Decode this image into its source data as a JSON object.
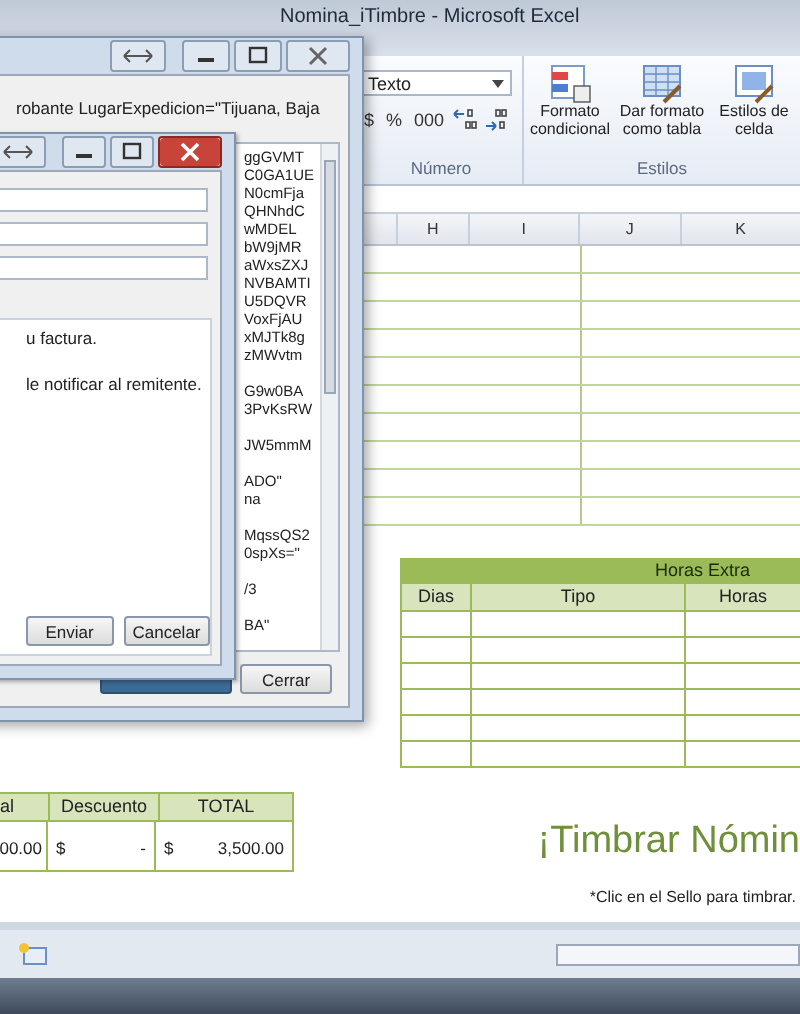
{
  "window": {
    "title": "Nomina_iTimbre - Microsoft Excel"
  },
  "ribbon": {
    "number_format": "Texto",
    "number_buttons": [
      "$",
      "%",
      "000"
    ],
    "number_group": "Número",
    "styles": [
      {
        "label": "Formato condicional",
        "kind": "conditional"
      },
      {
        "label": "Dar formato como tabla",
        "kind": "table"
      },
      {
        "label": "Estilos de celda",
        "kind": "cell"
      }
    ],
    "styles_group": "Estilos"
  },
  "columns": [
    "H",
    "I",
    "J",
    "K"
  ],
  "overtime": {
    "title": "Horas Extra",
    "columns": [
      "Dias",
      "Tipo",
      "Horas"
    ]
  },
  "totals": {
    "columns": [
      "al",
      "Descuento",
      "TOTAL"
    ],
    "cells": [
      {
        "amount": "00.00"
      },
      {
        "currency": "$",
        "amount": "-"
      },
      {
        "currency": "$",
        "amount": "3,500.00"
      }
    ]
  },
  "stamp": {
    "heading": "¡Timbrar Nómin",
    "note": "*Clic en el Sello para timbrar."
  },
  "xml_window": {
    "header_text": "robante LugarExpedicion=\"Tijuana, Baja",
    "line_groups": [
      [
        "ggGVMT",
        "C0GA1UE",
        "N0cmFja",
        "QHNhdC",
        "wMDEL",
        "bW9jMR",
        "aWxsZXJ",
        "NVBAMTI",
        "U5DQVR",
        "VoxFjAU",
        "xMJTk8g",
        "zMWvtm"
      ],
      [
        "G9w0BA",
        "3PvKsRW"
      ],
      [
        "JW5mmM"
      ],
      [
        "ADO\"",
        "na"
      ],
      [
        "MqssQS2",
        "0spXs=\""
      ],
      [
        "/3"
      ],
      [
        "BA\""
      ]
    ],
    "button": "Cerrar"
  },
  "mail_dialog": {
    "messages": [
      "u factura.",
      "le notificar al remitente."
    ],
    "buttons": [
      "Enviar",
      "Cancelar"
    ]
  }
}
